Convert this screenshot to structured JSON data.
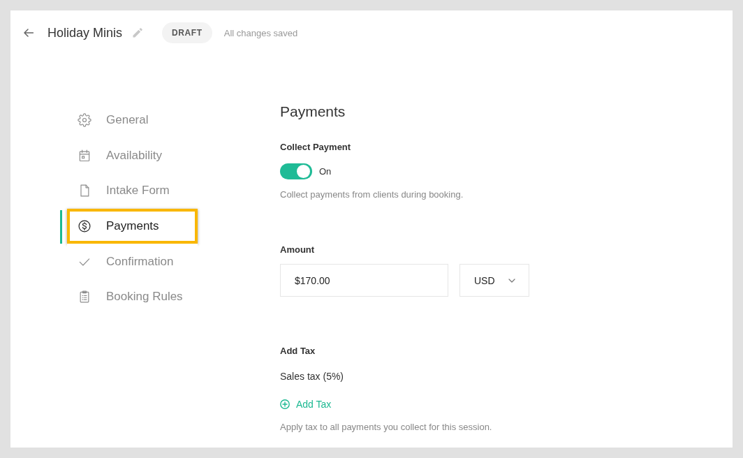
{
  "header": {
    "title": "Holiday Minis",
    "status_badge": "DRAFT",
    "save_status": "All changes saved"
  },
  "sidebar": {
    "items": [
      {
        "label": "General",
        "selected": false,
        "highlighted": false
      },
      {
        "label": "Availability",
        "selected": false,
        "highlighted": false
      },
      {
        "label": "Intake Form",
        "selected": false,
        "highlighted": false
      },
      {
        "label": "Payments",
        "selected": true,
        "highlighted": true
      },
      {
        "label": "Confirmation",
        "selected": false,
        "highlighted": false
      },
      {
        "label": "Booking Rules",
        "selected": false,
        "highlighted": false
      }
    ]
  },
  "payments": {
    "heading": "Payments",
    "collect_payment": {
      "label": "Collect Payment",
      "on": true,
      "state_label": "On",
      "help": "Collect payments from clients during booking."
    },
    "amount": {
      "label": "Amount",
      "value": "$170.00",
      "currency": "USD"
    },
    "tax": {
      "label": "Add Tax",
      "items": [
        "Sales tax (5%)"
      ],
      "add_link": "Add Tax",
      "help": "Apply tax to all payments you collect for this session."
    }
  }
}
